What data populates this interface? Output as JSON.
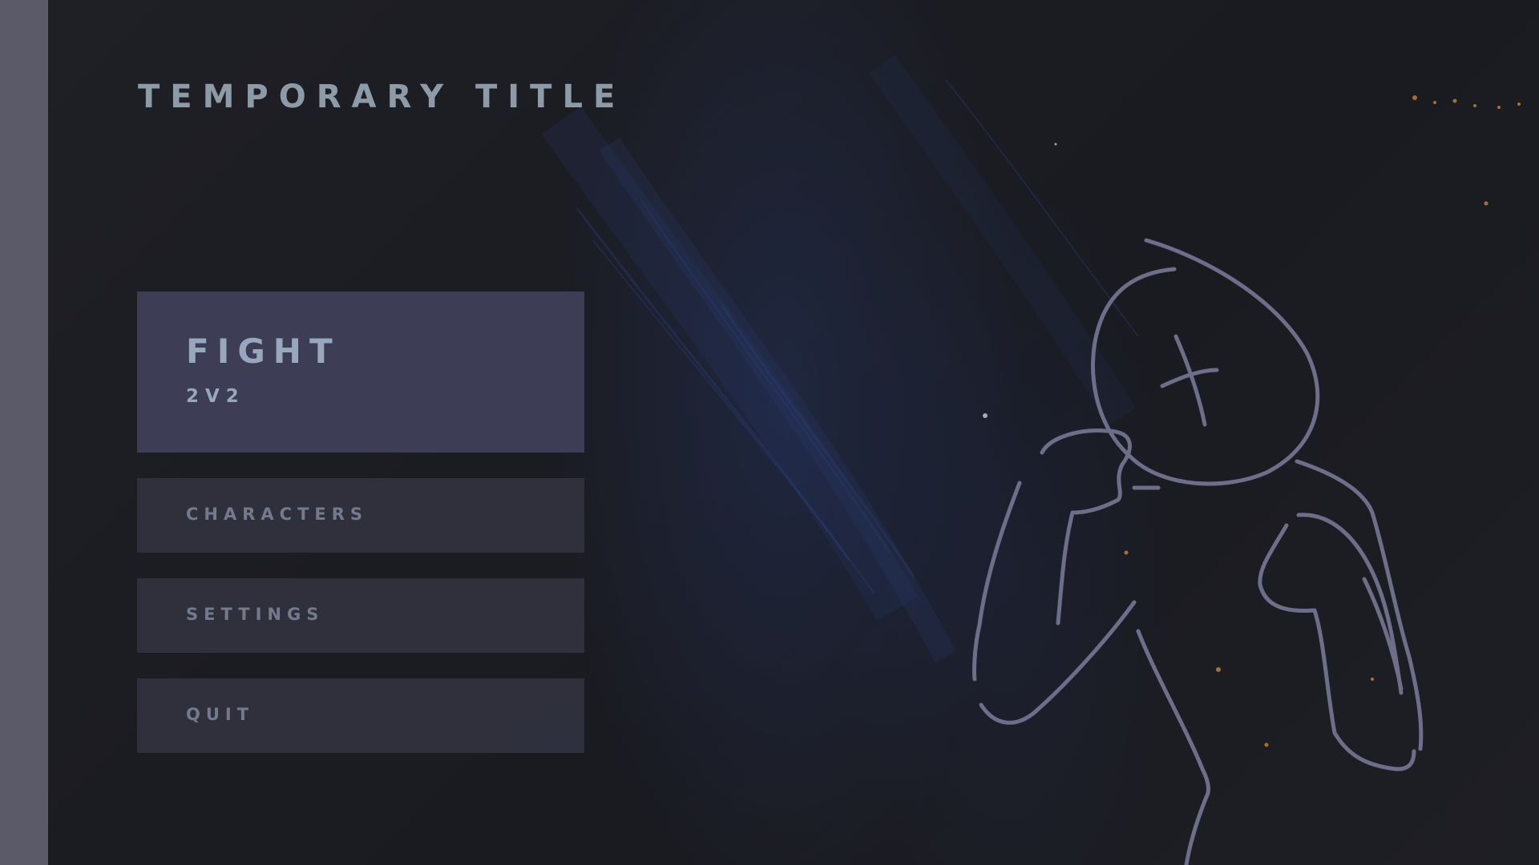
{
  "title": "TEMPORARY TITLE",
  "menu": {
    "fight": {
      "label": "FIGHT",
      "mode": "2V2"
    },
    "characters": {
      "label": "CHARACTERS"
    },
    "settings": {
      "label": "SETTINGS"
    },
    "quit": {
      "label": "QUIT"
    }
  },
  "colors": {
    "background": "#1e1e22",
    "side_rail": "#5a5a68",
    "title_text": "#8d9aa8",
    "fight_button": "#40405a",
    "menu_button": "#343442",
    "menu_text": "#747a8e",
    "sketch_stroke": "#6e6e8a"
  },
  "icons": {
    "character_sketch": "stick-figure-sketch"
  }
}
